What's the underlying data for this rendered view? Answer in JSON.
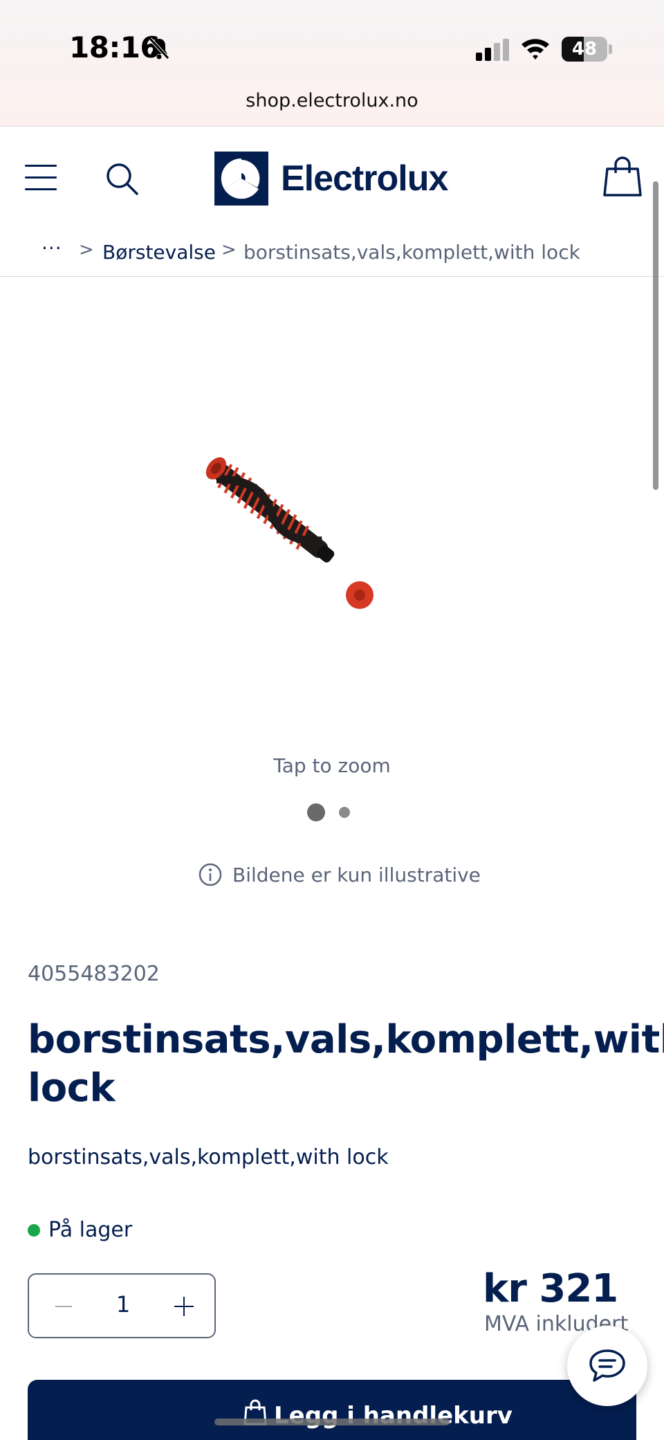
{
  "status_bar": {
    "time": "18:16",
    "battery": "48",
    "battery_level": 0.48,
    "url": "shop.electrolux.no"
  },
  "header": {
    "logo_text": "Electrolux",
    "brand_color": "#041e50"
  },
  "breadcrumb": {
    "more": "···",
    "separator": ">",
    "items": [
      "Børstevalse"
    ],
    "current": "borstinsats,vals,komplett,with lock"
  },
  "gallery": {
    "tap_to_zoom": "Tap to zoom",
    "image_count": 2,
    "active_index": 0,
    "illustrative_note": "Bildene er kun illustrative"
  },
  "product": {
    "sku": "4055483202",
    "title": "borstinsats,vals,komplett,with lock",
    "subtitle": "borstinsats,vals,komplett,with lock",
    "stock_status": "På lager",
    "stock_color": "#1aa64b",
    "quantity": "1",
    "price": "kr 321",
    "vat_note": "MVA inkludert"
  },
  "actions": {
    "add_to_cart": "Legg i handlekurv"
  },
  "icons": [
    "bell-slash-icon",
    "signal-icon",
    "wifi-icon",
    "battery-icon",
    "menu-icon",
    "search-icon",
    "shopping-bag-icon",
    "info-icon",
    "minus-icon",
    "plus-icon",
    "chat-icon"
  ]
}
